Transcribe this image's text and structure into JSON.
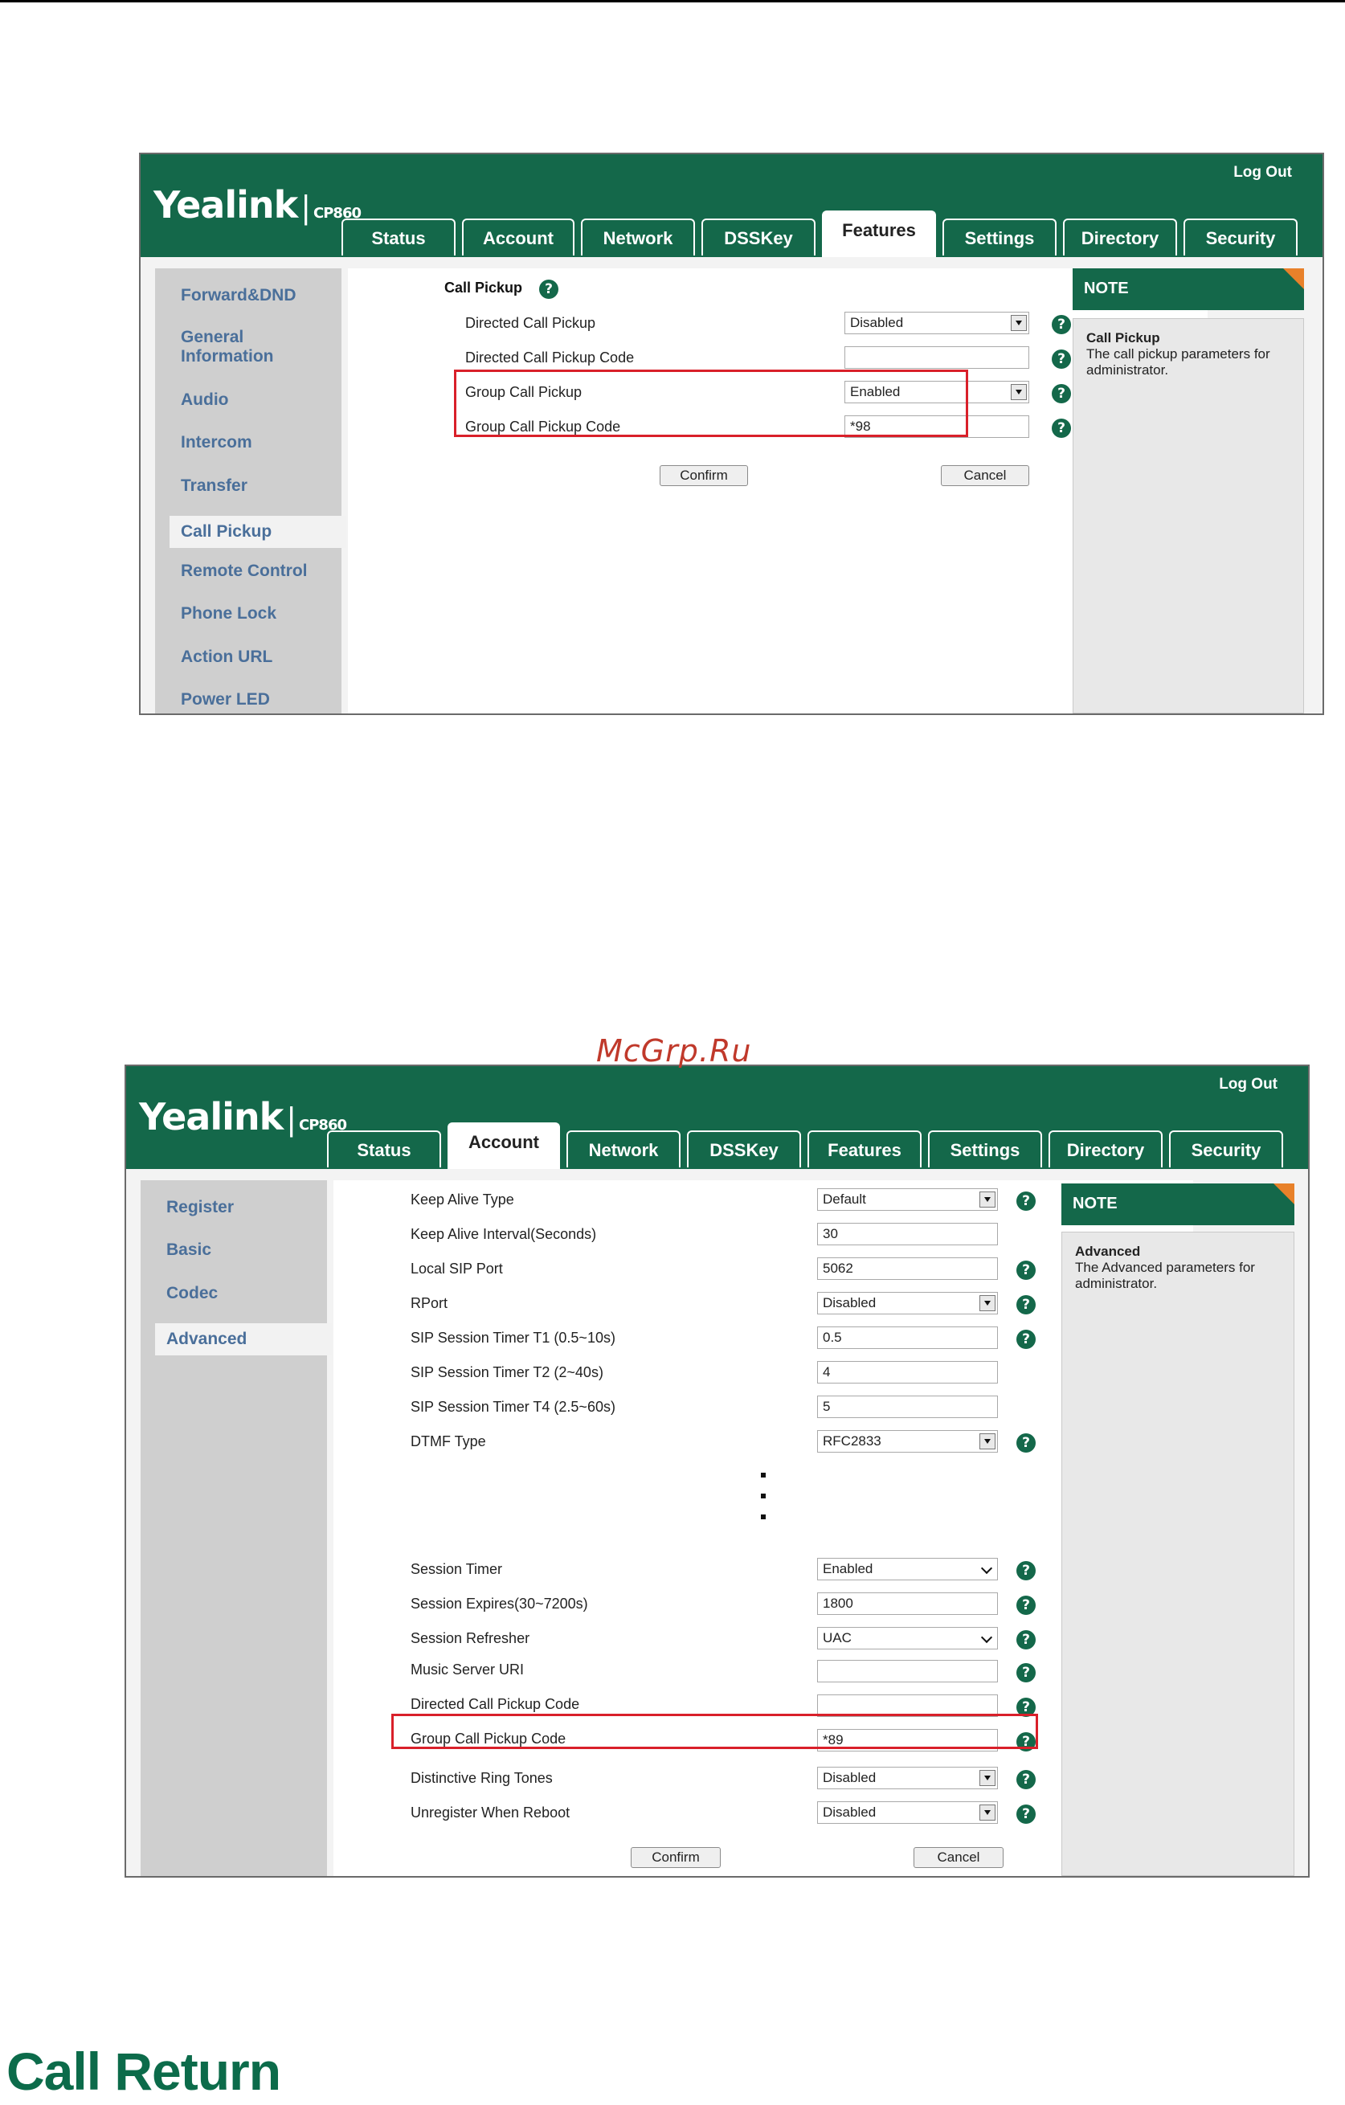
{
  "watermark": "McGrp.Ru",
  "section_heading": "Call Return",
  "shot1": {
    "logout": "Log Out",
    "logo": {
      "brand": "Yealink",
      "model": "CP860"
    },
    "tabs": [
      "Status",
      "Account",
      "Network",
      "DSSKey",
      "Features",
      "Settings",
      "Directory",
      "Security"
    ],
    "active_tab": "Features",
    "sidebar": [
      "Forward&DND",
      "General Information",
      "Audio",
      "Intercom",
      "Transfer",
      "Call Pickup",
      "Remote Control",
      "Phone Lock",
      "Action URL",
      "Power LED"
    ],
    "sidebar_active": "Call Pickup",
    "section_title": "Call Pickup",
    "fields": [
      {
        "label": "Directed Call Pickup",
        "value": "Disabled"
      },
      {
        "label": "Directed Call Pickup Code",
        "value": ""
      },
      {
        "label": "Group Call Pickup",
        "value": "Enabled"
      },
      {
        "label": "Group Call Pickup Code",
        "value": "*98"
      }
    ],
    "confirm": "Confirm",
    "cancel": "Cancel",
    "note": {
      "header": "NOTE",
      "title": "Call Pickup",
      "text": "The call pickup parameters for administrator."
    }
  },
  "shot2": {
    "logout": "Log Out",
    "logo": {
      "brand": "Yealink",
      "model": "CP860"
    },
    "tabs": [
      "Status",
      "Account",
      "Network",
      "DSSKey",
      "Features",
      "Settings",
      "Directory",
      "Security"
    ],
    "active_tab": "Account",
    "sidebar": [
      "Register",
      "Basic",
      "Codec",
      "Advanced"
    ],
    "sidebar_active": "Advanced",
    "fields_top": [
      {
        "label": "Keep Alive Type",
        "value": "Default"
      },
      {
        "label": "Keep Alive Interval(Seconds)",
        "value": "30"
      },
      {
        "label": "Local SIP Port",
        "value": "5062"
      },
      {
        "label": "RPort",
        "value": "Disabled"
      },
      {
        "label": "SIP Session Timer T1 (0.5~10s)",
        "value": "0.5"
      },
      {
        "label": "SIP Session Timer T2 (2~40s)",
        "value": "4"
      },
      {
        "label": "SIP Session Timer T4 (2.5~60s)",
        "value": "5"
      },
      {
        "label": "DTMF Type",
        "value": "RFC2833"
      }
    ],
    "fields_bottom": [
      {
        "label": "Session Timer",
        "value": "Enabled"
      },
      {
        "label": "Session Expires(30~7200s)",
        "value": "1800"
      },
      {
        "label": "Session Refresher",
        "value": "UAC"
      },
      {
        "label": "Music Server URI",
        "value": ""
      },
      {
        "label": "Directed Call Pickup Code",
        "value": ""
      },
      {
        "label": "Group Call Pickup Code",
        "value": "*89"
      },
      {
        "label": "Distinctive Ring Tones",
        "value": "Disabled"
      },
      {
        "label": "Unregister When Reboot",
        "value": "Disabled"
      }
    ],
    "confirm": "Confirm",
    "cancel": "Cancel",
    "note": {
      "header": "NOTE",
      "title": "Advanced",
      "text": "The Advanced parameters for administrator."
    }
  },
  "colors": {
    "brand_green": "#14684a",
    "highlight_red": "#d9202a",
    "sidebar_link": "#4a6f9a",
    "note_fold": "#e8812a"
  },
  "icons": {
    "help": "help-question-icon",
    "dropdown": "dropdown-arrow-icon"
  }
}
